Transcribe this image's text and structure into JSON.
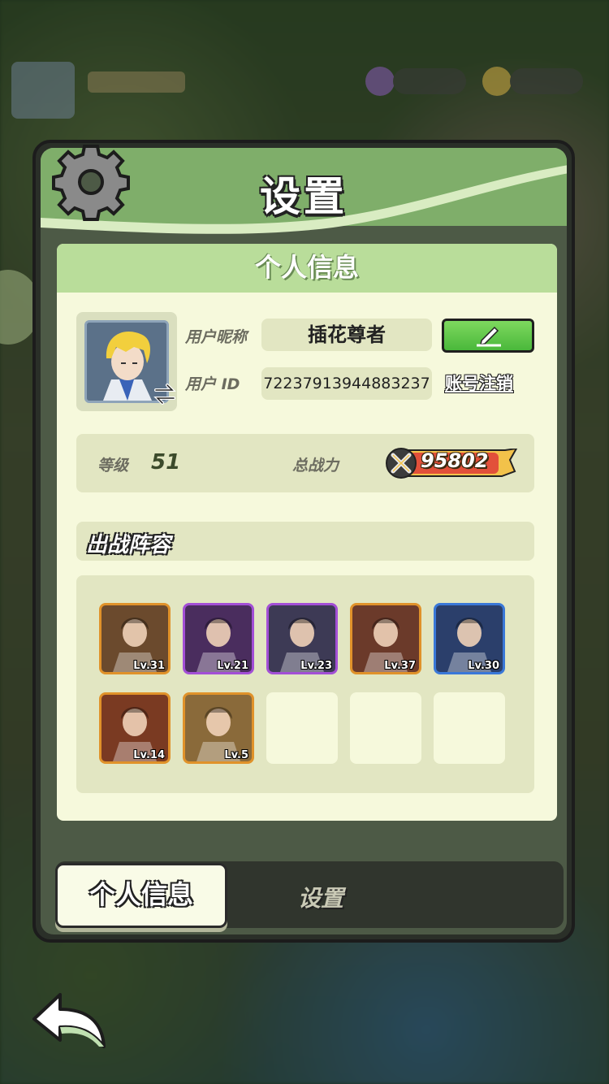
{
  "title": "设置",
  "card": {
    "header": "个人信息",
    "nickname_label": "用户昵称",
    "nickname": "插花尊者",
    "id_label": "用户 ID",
    "user_id": "7223791394488323​7",
    "logout_label": "账号注销",
    "level_label": "等级",
    "level": "51",
    "power_label": "总战力",
    "power": "95802",
    "lineup_title": "出战阵容"
  },
  "heroes": [
    {
      "lv": "Lv.31",
      "icon": "wizard-hero-portrait",
      "frame": "#e0922a",
      "bg": "#6b4a2d"
    },
    {
      "lv": "Lv.21",
      "icon": "goat-demon-hero-portrait",
      "frame": "#a34fd6",
      "bg": "#4a2d5e"
    },
    {
      "lv": "Lv.23",
      "icon": "horned-beast-hero-portrait",
      "frame": "#a34fd6",
      "bg": "#3d3a55"
    },
    {
      "lv": "Lv.37",
      "icon": "red-hair-hero-portrait",
      "frame": "#e0922a",
      "bg": "#6b3a2a"
    },
    {
      "lv": "Lv.30",
      "icon": "blonde-knight-hero-portrait",
      "frame": "#3a78d8",
      "bg": "#2b3f6b"
    },
    {
      "lv": "Lv.14",
      "icon": "king-hero-portrait",
      "frame": "#e0922a",
      "bg": "#7a3a22"
    },
    {
      "lv": "Lv.5",
      "icon": "white-priestess-hero-portrait",
      "frame": "#e0922a",
      "bg": "#8a6a3a"
    }
  ],
  "empty_slots": 3,
  "tabs": {
    "active": "个人信息",
    "inactive": "设置"
  },
  "colors": {
    "accent_green": "#7fae6a",
    "card_bg": "#f6f9dc",
    "power_bar": "#f2c24a"
  }
}
